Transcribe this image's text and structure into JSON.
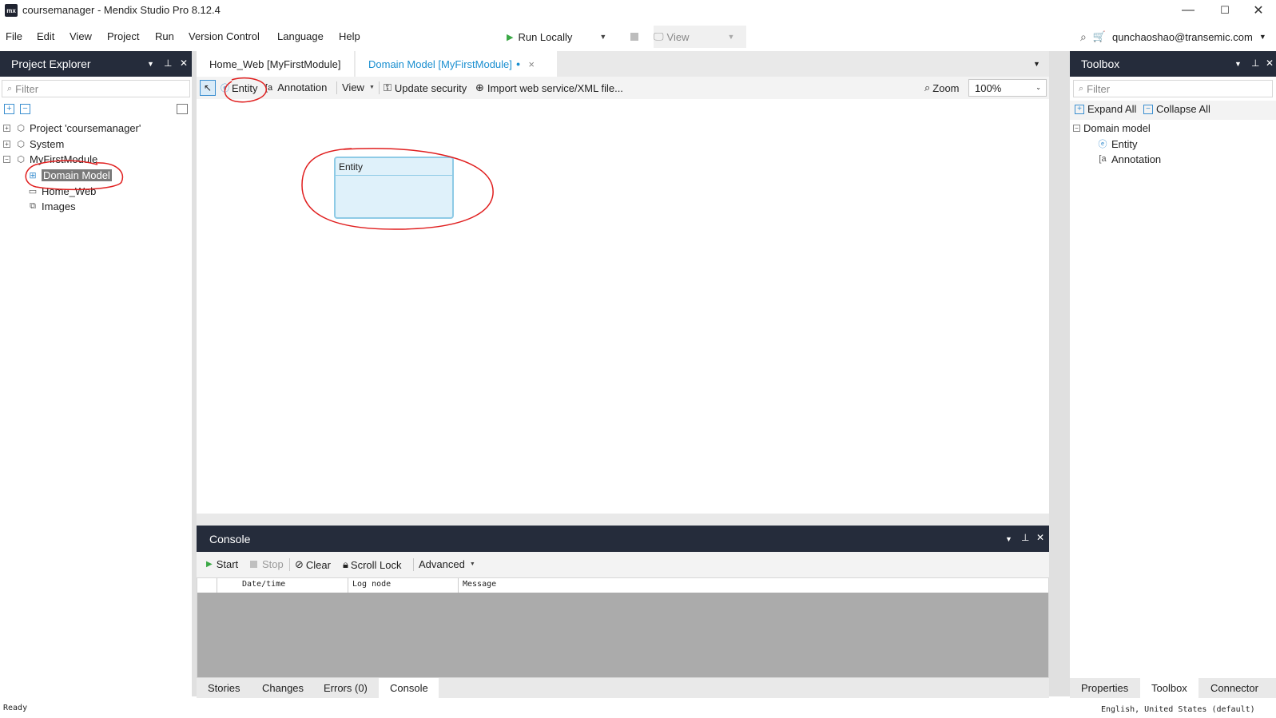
{
  "window": {
    "logo": "mx",
    "title": "coursemanager - Mendix Studio Pro 8.12.4",
    "controls": [
      "—",
      "☐",
      "✕"
    ]
  },
  "menu": [
    {
      "label": "File"
    },
    {
      "label": "Edit"
    },
    {
      "label": "View"
    },
    {
      "label": "Project"
    },
    {
      "label": "Run"
    },
    {
      "label": "Version Control"
    },
    {
      "label": "Language"
    },
    {
      "label": "Help"
    }
  ],
  "run": {
    "label": "Run Locally",
    "view_label": "View"
  },
  "user": {
    "email": "qunchaoshao@transemic.com"
  },
  "project_explorer": {
    "title": "Project Explorer",
    "filter_placeholder": "Filter",
    "tree": [
      {
        "label": "Project 'coursemanager'",
        "toggle": "+"
      },
      {
        "label": "System",
        "toggle": "+"
      },
      {
        "label": "MyFirstModule",
        "toggle": "−"
      },
      {
        "label": "Domain Model",
        "selected": true
      },
      {
        "label": "Home_Web"
      },
      {
        "label": "Images"
      }
    ]
  },
  "tabs": [
    {
      "label": "Home_Web [MyFirstModule]",
      "active": false
    },
    {
      "label": "Domain Model [MyFirstModule]",
      "active": true,
      "dirty_dot": "●",
      "close": "×"
    }
  ],
  "canvas_toolbar": {
    "entity": "Entity",
    "annotation": "Annotation",
    "view": "View",
    "update_security": "Update security",
    "import": "Import web service/XML file...",
    "zoom_label": "Zoom",
    "zoom_value": "100%"
  },
  "entity_box": {
    "name": "Entity"
  },
  "console": {
    "title": "Console",
    "start": "Start",
    "stop": "Stop",
    "clear": "Clear",
    "scroll_lock": "Scroll Lock",
    "advanced": "Advanced",
    "columns": [
      "Date/time",
      "Log node",
      "Message"
    ]
  },
  "bottom_tabs": [
    {
      "label": "Stories"
    },
    {
      "label": "Changes"
    },
    {
      "label": "Errors (0)"
    },
    {
      "label": "Console",
      "active": true
    }
  ],
  "toolbox": {
    "title": "Toolbox",
    "filter_placeholder": "Filter",
    "expand_all": "Expand All",
    "collapse_all": "Collapse All",
    "group": "Domain model",
    "items": [
      {
        "label": "Entity"
      },
      {
        "label": "Annotation"
      }
    ]
  },
  "right_tabs": [
    {
      "label": "Properties"
    },
    {
      "label": "Toolbox",
      "active": true
    },
    {
      "label": "Connector"
    }
  ],
  "status": {
    "left": "Ready",
    "right": "English, United States (default)"
  },
  "colors": {
    "dark_header": "#252c3b",
    "accent": "#1a8fd0",
    "annotation": "#e01e1e",
    "entity_fill": "#dff1fa"
  }
}
